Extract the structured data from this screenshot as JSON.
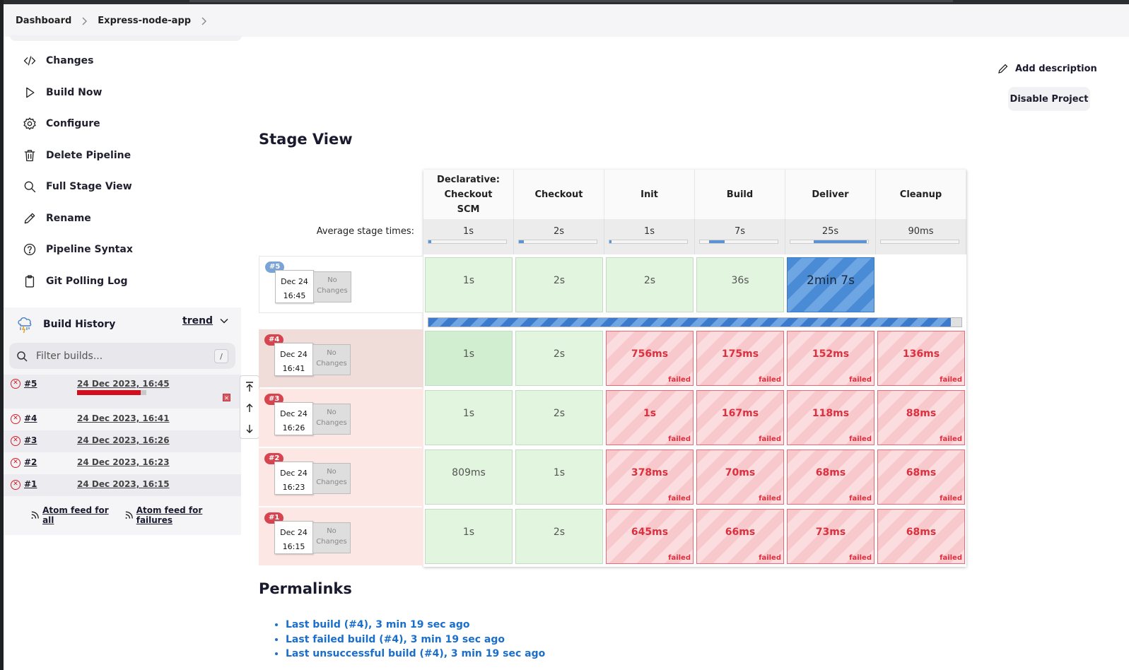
{
  "breadcrumb": [
    "Dashboard",
    "Express-node-app"
  ],
  "nav": [
    {
      "label": "Changes",
      "icon": "code-icon"
    },
    {
      "label": "Build Now",
      "icon": "play-icon"
    },
    {
      "label": "Configure",
      "icon": "gear-icon"
    },
    {
      "label": "Delete Pipeline",
      "icon": "trash-icon"
    },
    {
      "label": "Full Stage View",
      "icon": "search-icon"
    },
    {
      "label": "Rename",
      "icon": "pencil-icon"
    },
    {
      "label": "Pipeline Syntax",
      "icon": "help-icon"
    },
    {
      "label": "Git Polling Log",
      "icon": "clipboard-icon"
    }
  ],
  "build_history": {
    "title": "Build History",
    "trend": "trend",
    "filter_placeholder": "Filter builds...",
    "filter_shortcut": "/",
    "runs": [
      {
        "num": "#5",
        "date": "24 Dec 2023, 16:45",
        "status": "failed",
        "progress": 0.92
      },
      {
        "num": "#4",
        "date": "24 Dec 2023, 16:41",
        "status": "failed"
      },
      {
        "num": "#3",
        "date": "24 Dec 2023, 16:26",
        "status": "failed"
      },
      {
        "num": "#2",
        "date": "24 Dec 2023, 16:23",
        "status": "failed"
      },
      {
        "num": "#1",
        "date": "24 Dec 2023, 16:15",
        "status": "failed"
      }
    ],
    "feed_all": "Atom feed for all",
    "feed_failures": "Atom feed for failures"
  },
  "actions": {
    "add_description": "Add description",
    "disable_project": "Disable Project"
  },
  "stage_view": {
    "title": "Stage View",
    "avg_label": "Average stage times:",
    "stages": [
      {
        "name": "Declarative: Checkout SCM",
        "avg": "1s",
        "avg_fraction": 0.04
      },
      {
        "name": "Checkout",
        "avg": "2s",
        "avg_fraction": 0.06
      },
      {
        "name": "Init",
        "avg": "1s",
        "avg_fraction": 0.03
      },
      {
        "name": "Build",
        "avg": "7s",
        "avg_fraction": 0.2
      },
      {
        "name": "Deliver",
        "avg": "25s",
        "avg_fraction": 0.68
      },
      {
        "name": "Cleanup",
        "avg": "90ms",
        "avg_fraction": 0.0
      }
    ],
    "builds": [
      {
        "badge": "#5",
        "date": "Dec 24",
        "time": "16:45",
        "changes": "No Changes",
        "state": "running",
        "cells": [
          {
            "t": "1s",
            "s": "ok"
          },
          {
            "t": "2s",
            "s": "ok"
          },
          {
            "t": "2s",
            "s": "ok"
          },
          {
            "t": "36s",
            "s": "ok"
          },
          {
            "t": "2min 7s",
            "s": "running"
          },
          {
            "t": "",
            "s": "empty"
          }
        ],
        "progress": 0.98
      },
      {
        "badge": "#4",
        "date": "Dec 24",
        "time": "16:41",
        "changes": "No Changes",
        "state": "failed",
        "cells": [
          {
            "t": "1s",
            "s": "ok"
          },
          {
            "t": "2s",
            "s": "ok"
          },
          {
            "t": "756ms",
            "s": "fail"
          },
          {
            "t": "175ms",
            "s": "fail"
          },
          {
            "t": "152ms",
            "s": "fail"
          },
          {
            "t": "136ms",
            "s": "fail"
          }
        ]
      },
      {
        "badge": "#3",
        "date": "Dec 24",
        "time": "16:26",
        "changes": "No Changes",
        "state": "failed",
        "cells": [
          {
            "t": "1s",
            "s": "ok"
          },
          {
            "t": "2s",
            "s": "ok"
          },
          {
            "t": "1s",
            "s": "fail"
          },
          {
            "t": "167ms",
            "s": "fail"
          },
          {
            "t": "118ms",
            "s": "fail"
          },
          {
            "t": "88ms",
            "s": "fail"
          }
        ]
      },
      {
        "badge": "#2",
        "date": "Dec 24",
        "time": "16:23",
        "changes": "No Changes",
        "state": "failed",
        "cells": [
          {
            "t": "809ms",
            "s": "ok"
          },
          {
            "t": "1s",
            "s": "ok"
          },
          {
            "t": "378ms",
            "s": "fail"
          },
          {
            "t": "70ms",
            "s": "fail"
          },
          {
            "t": "68ms",
            "s": "fail"
          },
          {
            "t": "68ms",
            "s": "fail"
          }
        ]
      },
      {
        "badge": "#1",
        "date": "Dec 24",
        "time": "16:15",
        "changes": "No Changes",
        "state": "failed",
        "cells": [
          {
            "t": "1s",
            "s": "ok"
          },
          {
            "t": "2s",
            "s": "ok"
          },
          {
            "t": "645ms",
            "s": "fail"
          },
          {
            "t": "66ms",
            "s": "fail"
          },
          {
            "t": "73ms",
            "s": "fail"
          },
          {
            "t": "68ms",
            "s": "fail"
          }
        ]
      }
    ],
    "failed_label": "failed"
  },
  "permalinks": {
    "title": "Permalinks",
    "items": [
      "Last build (#4), 3 min 19 sec ago",
      "Last failed build (#4), 3 min 19 sec ago",
      "Last unsuccessful build (#4), 3 min 19 sec ago"
    ]
  },
  "colors": {
    "failed": "#dd2f3d",
    "running": "#4a8bd5",
    "success": "#e1f5df",
    "link": "#1a6ecc"
  }
}
